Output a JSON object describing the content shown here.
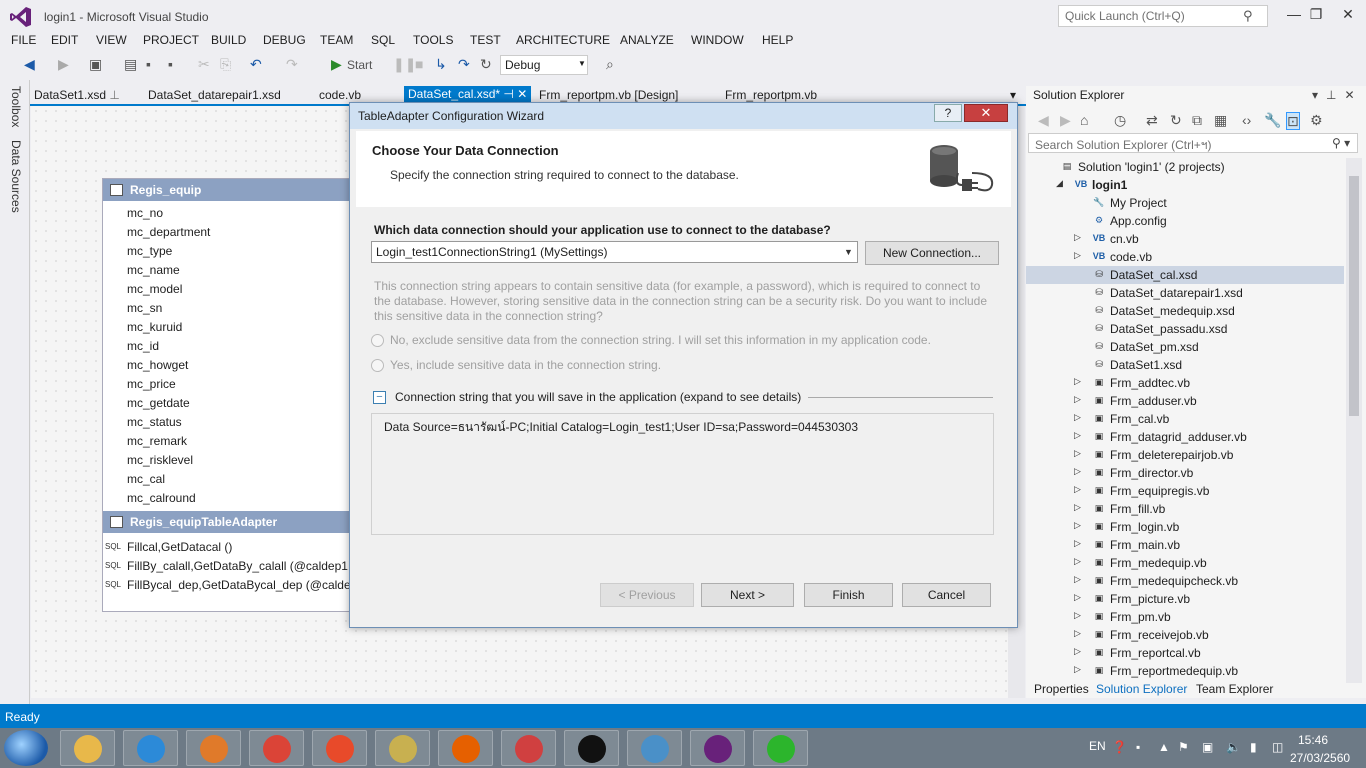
{
  "window": {
    "title": "login1 - Microsoft Visual Studio",
    "quick_launch_placeholder": "Quick Launch (Ctrl+Q)"
  },
  "menu": [
    "FILE",
    "EDIT",
    "VIEW",
    "PROJECT",
    "BUILD",
    "DEBUG",
    "TEAM",
    "SQL",
    "TOOLS",
    "TEST",
    "ARCHITECTURE",
    "ANALYZE",
    "WINDOW",
    "HELP"
  ],
  "toolbar": {
    "start_label": "Start",
    "config": "Debug"
  },
  "side_strip": {
    "toolbox": "Toolbox",
    "data_sources": "Data Sources"
  },
  "doc_tabs": [
    "DataSet1.xsd",
    "DataSet_datarepair1.xsd",
    "code.vb",
    "DataSet_cal.xsd*",
    "Frm_reportpm.vb [Design]",
    "Frm_reportpm.vb"
  ],
  "table": {
    "name": "Regis_equip",
    "columns": [
      "mc_no",
      "mc_department",
      "mc_type",
      "mc_name",
      "mc_model",
      "mc_sn",
      "mc_kuruid",
      "mc_id",
      "mc_howget",
      "mc_price",
      "mc_getdate",
      "mc_status",
      "mc_remark",
      "mc_risklevel",
      "mc_cal",
      "mc_calround"
    ],
    "adapter_name": "Regis_equipTableAdapter",
    "sql_label": "SQL",
    "queries": [
      "Fillcal,GetDatacal ()",
      "FillBy_calall,GetDataBy_calall (@caldep1, @",
      "FillBycal_dep,GetDataBycal_dep (@caldep,"
    ]
  },
  "dialog": {
    "title": "TableAdapter Configuration Wizard",
    "heading": "Choose Your Data Connection",
    "subheading": "Specify the connection string required to connect to the database.",
    "question": "Which data connection should your application use to connect to the database?",
    "connection": "Login_test1ConnectionString1 (MySettings)",
    "new_connection": "New Connection...",
    "info": "This connection string appears to contain sensitive data (for example, a password), which is required to connect to the database. However, storing sensitive data in the connection string can be a security risk. Do you want to include this sensitive data in the connection string?",
    "option_no": "No, exclude sensitive data from the connection string. I will set this information in my application code.",
    "option_yes": "Yes, include sensitive data in the connection string.",
    "expander_label": "Connection string that you will save in the application (expand to see details)",
    "connection_string": "Data Source=ธนารัฒน์-PC;Initial Catalog=Login_test1;User ID=sa;Password=044530303",
    "btn_previous": "< Previous",
    "btn_next": "Next >",
    "btn_finish": "Finish",
    "btn_cancel": "Cancel"
  },
  "solution_explorer": {
    "title": "Solution Explorer",
    "search_placeholder": "Search Solution Explorer (Ctrl+ฯ)",
    "items": [
      {
        "label": "Solution 'login1' (2 projects)",
        "icon": "solution-icon",
        "level": 0,
        "exp": ""
      },
      {
        "label": "login1",
        "icon": "vb-project-icon",
        "level": 1,
        "exp": "◢"
      },
      {
        "label": "My Project",
        "icon": "wrench-icon",
        "level": 2,
        "exp": ""
      },
      {
        "label": "App.config",
        "icon": "config-icon",
        "level": 2,
        "exp": ""
      },
      {
        "label": "cn.vb",
        "icon": "vb-file-icon",
        "level": 2,
        "exp": "▷"
      },
      {
        "label": "code.vb",
        "icon": "vb-file-icon",
        "level": 2,
        "exp": "▷"
      },
      {
        "label": "DataSet_cal.xsd",
        "icon": "dataset-icon",
        "level": 2,
        "exp": "",
        "selected": true
      },
      {
        "label": "DataSet_datarepair1.xsd",
        "icon": "dataset-icon",
        "level": 2,
        "exp": ""
      },
      {
        "label": "DataSet_medequip.xsd",
        "icon": "dataset-icon",
        "level": 2,
        "exp": ""
      },
      {
        "label": "DataSet_passadu.xsd",
        "icon": "dataset-icon",
        "level": 2,
        "exp": ""
      },
      {
        "label": "DataSet_pm.xsd",
        "icon": "dataset-icon",
        "level": 2,
        "exp": ""
      },
      {
        "label": "DataSet1.xsd",
        "icon": "dataset-icon",
        "level": 2,
        "exp": ""
      },
      {
        "label": "Frm_addtec.vb",
        "icon": "form-icon",
        "level": 2,
        "exp": "▷"
      },
      {
        "label": "Frm_adduser.vb",
        "icon": "form-icon",
        "level": 2,
        "exp": "▷"
      },
      {
        "label": "Frm_cal.vb",
        "icon": "form-icon",
        "level": 2,
        "exp": "▷"
      },
      {
        "label": "Frm_datagrid_adduser.vb",
        "icon": "form-icon",
        "level": 2,
        "exp": "▷"
      },
      {
        "label": "Frm_deleterepairjob.vb",
        "icon": "form-icon",
        "level": 2,
        "exp": "▷"
      },
      {
        "label": "Frm_director.vb",
        "icon": "form-icon",
        "level": 2,
        "exp": "▷"
      },
      {
        "label": "Frm_equipregis.vb",
        "icon": "form-icon",
        "level": 2,
        "exp": "▷"
      },
      {
        "label": "Frm_fill.vb",
        "icon": "form-icon",
        "level": 2,
        "exp": "▷"
      },
      {
        "label": "Frm_login.vb",
        "icon": "form-icon",
        "level": 2,
        "exp": "▷"
      },
      {
        "label": "Frm_main.vb",
        "icon": "form-icon",
        "level": 2,
        "exp": "▷"
      },
      {
        "label": "Frm_medequip.vb",
        "icon": "form-icon",
        "level": 2,
        "exp": "▷"
      },
      {
        "label": "Frm_medequipcheck.vb",
        "icon": "form-icon",
        "level": 2,
        "exp": "▷"
      },
      {
        "label": "Frm_picture.vb",
        "icon": "form-icon",
        "level": 2,
        "exp": "▷"
      },
      {
        "label": "Frm_pm.vb",
        "icon": "form-icon",
        "level": 2,
        "exp": "▷"
      },
      {
        "label": "Frm_receivejob.vb",
        "icon": "form-icon",
        "level": 2,
        "exp": "▷"
      },
      {
        "label": "Frm_reportcal.vb",
        "icon": "form-icon",
        "level": 2,
        "exp": "▷"
      },
      {
        "label": "Frm_reportmedequip.vb",
        "icon": "form-icon",
        "level": 2,
        "exp": "▷"
      }
    ],
    "bottom_tabs": [
      "Properties",
      "Solution Explorer",
      "Team Explorer"
    ]
  },
  "status": {
    "text": "Ready"
  },
  "taskbar": {
    "language": "EN",
    "time": "15:46",
    "date": "27/03/2560",
    "apps": [
      {
        "name": "file-explorer-icon",
        "color": "#e8b84a"
      },
      {
        "name": "internet-explorer-icon",
        "color": "#2c8ad8"
      },
      {
        "name": "media-player-icon",
        "color": "#e07a2a"
      },
      {
        "name": "chrome-icon",
        "color": "#db4437"
      },
      {
        "name": "kmplayer-icon",
        "color": "#e84a2a"
      },
      {
        "name": "tools-icon",
        "color": "#c8b050"
      },
      {
        "name": "firefox-icon",
        "color": "#e66000"
      },
      {
        "name": "settings-wrench-icon",
        "color": "#d04040"
      },
      {
        "name": "command-prompt-icon",
        "color": "#111111"
      },
      {
        "name": "remote-desktop-icon",
        "color": "#4a90c8"
      },
      {
        "name": "visual-studio-icon",
        "color": "#68217a"
      },
      {
        "name": "line-icon",
        "color": "#2cb52c"
      }
    ]
  },
  "colors": {
    "accent": "#007acc",
    "table_header": "#8ca1c2",
    "dialog_title": "#cfe0f2",
    "close": "#c74040"
  }
}
